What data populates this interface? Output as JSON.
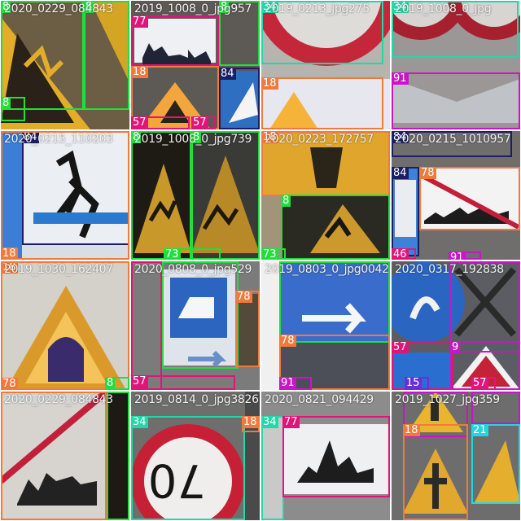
{
  "tiles": [
    {
      "filename": "2020_0229_084843",
      "bg": "#6c5d45",
      "boxes": [
        {
          "label": "8",
          "color": "#1ee03c",
          "l": 0,
          "t": 0,
          "w": 102,
          "h": 134,
          "lab": "tl"
        },
        {
          "label": "8",
          "color": "#1ee03c",
          "l": 102,
          "t": 0,
          "w": 56,
          "h": 134,
          "lab": "tl"
        },
        {
          "label": "8",
          "color": "#1ee03c",
          "l": 0,
          "t": 118,
          "w": 30,
          "h": 30,
          "lab": "tl"
        }
      ]
    },
    {
      "filename": "2019_1008_0_jpg957",
      "bg": "#5d5a55",
      "boxes": [
        {
          "label": "77",
          "color": "#e0157a",
          "l": 0,
          "t": 18,
          "w": 108,
          "h": 62,
          "lab": "tl"
        },
        {
          "label": "8",
          "color": "#1ee03c",
          "l": 108,
          "t": 0,
          "w": 50,
          "h": 80,
          "lab": "tl"
        },
        {
          "label": "18",
          "color": "#f07a3c",
          "l": 0,
          "t": 80,
          "w": 108,
          "h": 78,
          "lab": "tl"
        },
        {
          "label": "84",
          "color": "#1a1e63",
          "l": 108,
          "t": 82,
          "w": 50,
          "h": 76,
          "lab": "tl"
        },
        {
          "label": "57",
          "color": "#e0157a",
          "l": 0,
          "t": 142,
          "w": 72,
          "h": 16,
          "lab": "tl"
        },
        {
          "label": "57",
          "color": "#e0157a",
          "l": 74,
          "t": 142,
          "w": 30,
          "h": 16,
          "lab": "tl"
        }
      ]
    },
    {
      "filename": "2019_0213_jpg275",
      "bg": "#b7b3ae",
      "boxes": [
        {
          "label": "34",
          "color": "#20d9a8",
          "l": 0,
          "t": 0,
          "w": 150,
          "h": 78,
          "lab": "tl"
        },
        {
          "label": "18",
          "color": "#f07a3c",
          "l": 0,
          "t": 94,
          "w": 150,
          "h": 64,
          "lab": "tl"
        }
      ]
    },
    {
      "filename": "2019_1008_0_jpg",
      "bg": "#9a9796",
      "boxes": [
        {
          "label": "34",
          "color": "#20d9a8",
          "l": 0,
          "t": 0,
          "w": 156,
          "h": 70,
          "lab": "tl"
        },
        {
          "label": "91",
          "color": "#c815c8",
          "l": 0,
          "t": 88,
          "w": 158,
          "h": 70,
          "lab": "tl"
        }
      ]
    },
    {
      "filename": "2020_0215_110203",
      "bg": "#d9dde4",
      "boxes": [
        {
          "label": "84",
          "color": "#1a1e63",
          "l": 26,
          "t": 0,
          "w": 132,
          "h": 140,
          "lab": "tl"
        },
        {
          "label": "18",
          "color": "#f07a3c",
          "l": 0,
          "t": 0,
          "w": 158,
          "h": 158,
          "lab": "bl"
        }
      ]
    },
    {
      "filename": "2019_1008_0_jpg739",
      "bg": "#3a3a36",
      "boxes": [
        {
          "label": "8",
          "color": "#1ee03c",
          "l": 0,
          "t": 0,
          "w": 74,
          "h": 158,
          "lab": "tl"
        },
        {
          "label": "8",
          "color": "#1ee03c",
          "l": 74,
          "t": 0,
          "w": 84,
          "h": 158,
          "lab": "tl"
        },
        {
          "label": "73",
          "color": "#1ee03c",
          "l": 40,
          "t": 144,
          "w": 70,
          "h": 14,
          "lab": "tl"
        }
      ]
    },
    {
      "filename": "2020_0223_172757",
      "bg": "#a19478",
      "boxes": [
        {
          "label": "18",
          "color": "#f07a3c",
          "l": 0,
          "t": 0,
          "w": 158,
          "h": 80,
          "lab": "tl"
        },
        {
          "label": "8",
          "color": "#1ee03c",
          "l": 24,
          "t": 78,
          "w": 134,
          "h": 80,
          "lab": "tl"
        },
        {
          "label": "73",
          "color": "#1ee03c",
          "l": 0,
          "t": 144,
          "w": 30,
          "h": 14,
          "lab": "tl"
        }
      ]
    },
    {
      "filename": "2020_0215_1010957",
      "bg": "#6f6e6c",
      "boxes": [
        {
          "label": "84",
          "color": "#1a1e63",
          "l": 0,
          "t": 0,
          "w": 148,
          "h": 32,
          "lab": "tl"
        },
        {
          "label": "84",
          "color": "#1a1e63",
          "l": 0,
          "t": 44,
          "w": 34,
          "h": 110,
          "lab": "tl"
        },
        {
          "label": "78",
          "color": "#f07a3c",
          "l": 34,
          "t": 44,
          "w": 124,
          "h": 78,
          "lab": "tl"
        },
        {
          "label": "46",
          "color": "#e0157a",
          "l": 0,
          "t": 144,
          "w": 30,
          "h": 14,
          "lab": "tl"
        },
        {
          "label": "91",
          "color": "#c815c8",
          "l": 70,
          "t": 148,
          "w": 40,
          "h": 10,
          "lab": "tl"
        }
      ]
    },
    {
      "filename": "2019_1030_162407",
      "bg": "#d4d1cb",
      "boxes": [
        {
          "label": "18",
          "color": "#f07a3c",
          "l": 0,
          "t": 0,
          "w": 158,
          "h": 158,
          "lab": "tl"
        },
        {
          "label": "78",
          "color": "#f07a3c",
          "l": 0,
          "t": 0,
          "w": 158,
          "h": 158,
          "lab": "bl"
        },
        {
          "label": "8",
          "color": "#1ee03c",
          "l": 128,
          "t": 142,
          "w": 30,
          "h": 16,
          "lab": "tl"
        }
      ]
    },
    {
      "filename": "2020_0808_0_jpg529",
      "bg": "#7b7b7b",
      "boxes": [
        {
          "label": "77",
          "color": "#e0157a",
          "l": 0,
          "t": 0,
          "w": 38,
          "h": 158,
          "lab": "bl"
        },
        {
          "label": "",
          "color": "#1ee03c",
          "l": 38,
          "t": 0,
          "w": 94,
          "h": 132,
          "lab": "none"
        },
        {
          "label": "78",
          "color": "#f07a3c",
          "l": 128,
          "t": 36,
          "w": 30,
          "h": 94,
          "lab": "tl"
        },
        {
          "label": "57",
          "color": "#e0157a",
          "l": 0,
          "t": 140,
          "w": 128,
          "h": 18,
          "lab": "tl"
        }
      ]
    },
    {
      "filename": "2019_0803_0_jpg0042",
      "bg": "#676a78",
      "boxes": [
        {
          "label": "",
          "color": "#1ee03c",
          "l": 22,
          "t": 0,
          "w": 136,
          "h": 100,
          "lab": "none"
        },
        {
          "label": "78",
          "color": "#f07a3c",
          "l": 22,
          "t": 90,
          "w": 136,
          "h": 68,
          "lab": "tl"
        },
        {
          "label": "91",
          "color": "#c815c8",
          "l": 22,
          "t": 142,
          "w": 40,
          "h": 16,
          "lab": "tl"
        }
      ]
    },
    {
      "filename": "2020_0317_192838",
      "bg": "#5b5d63",
      "boxes": [
        {
          "label": "",
          "color": "#c815c8",
          "l": 72,
          "t": 0,
          "w": 86,
          "h": 112,
          "lab": "none"
        },
        {
          "label": "57",
          "color": "#e0157a",
          "l": 0,
          "t": 98,
          "w": 76,
          "h": 60,
          "lab": "tl"
        },
        {
          "label": "9",
          "color": "#c815c8",
          "l": 72,
          "t": 98,
          "w": 86,
          "h": 60,
          "lab": "tl"
        },
        {
          "label": "15",
          "color": "#6a30d8",
          "l": 16,
          "t": 142,
          "w": 30,
          "h": 16,
          "lab": "tl"
        },
        {
          "label": "57",
          "color": "#e0157a",
          "l": 98,
          "t": 142,
          "w": 30,
          "h": 16,
          "lab": "tl"
        }
      ]
    },
    {
      "filename": "2020_0229_084843",
      "bg": "#8a8580",
      "boxes": [
        {
          "label": "",
          "color": "#f07a3c",
          "l": 0,
          "t": 0,
          "w": 130,
          "h": 158,
          "lab": "none"
        },
        {
          "label": "",
          "color": "#1ee03c",
          "l": 130,
          "t": 0,
          "w": 28,
          "h": 158,
          "lab": "none"
        }
      ]
    },
    {
      "filename": "2019_0814_0_jpg3826",
      "bg": "#6e6e6c",
      "boxes": [
        {
          "label": "34",
          "color": "#20d9a8",
          "l": 0,
          "t": 30,
          "w": 140,
          "h": 128,
          "lab": "tl"
        },
        {
          "label": "18",
          "color": "#f07a3c",
          "l": 136,
          "t": 30,
          "w": 22,
          "h": 20,
          "lab": "tl"
        }
      ]
    },
    {
      "filename": "2020_0821_094429",
      "bg": "#8c8c8c",
      "boxes": [
        {
          "label": "34",
          "color": "#20d9a8",
          "l": 0,
          "t": 30,
          "w": 28,
          "h": 128,
          "lab": "tl"
        },
        {
          "label": "77",
          "color": "#e0157a",
          "l": 26,
          "t": 30,
          "w": 132,
          "h": 100,
          "lab": "tl"
        }
      ]
    },
    {
      "filename": "2019_1027_jpg359",
      "bg": "#6d6d6d",
      "boxes": [
        {
          "label": "",
          "color": "#c815c8",
          "l": 14,
          "t": 0,
          "w": 80,
          "h": 56,
          "lab": "none"
        },
        {
          "label": "18",
          "color": "#f07a3c",
          "l": 14,
          "t": 40,
          "w": 80,
          "h": 118,
          "lab": "tl"
        },
        {
          "label": "21",
          "color": "#20d9e0",
          "l": 98,
          "t": 40,
          "w": 60,
          "h": 98,
          "lab": "tl"
        },
        {
          "label": "",
          "color": "#c815c8",
          "l": 98,
          "t": 0,
          "w": 60,
          "h": 40,
          "lab": "none"
        }
      ]
    }
  ]
}
